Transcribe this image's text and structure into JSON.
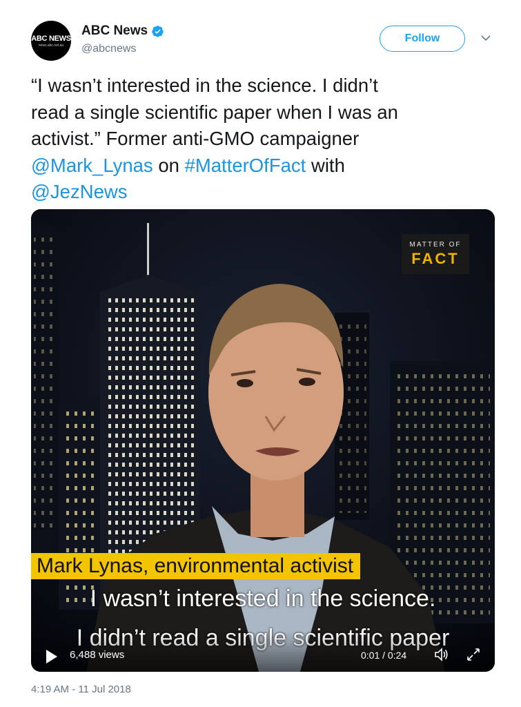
{
  "author": {
    "avatar_text": "ABC NEWS",
    "avatar_subtext": "news.abc.net.au",
    "name": "ABC News",
    "handle": "@abcnews",
    "verified_icon": "verified-badge-icon"
  },
  "follow_label": "Follow",
  "tweet": {
    "line1": "“I wasn’t interested in the science. I didn’t",
    "line2": "read a single scientific paper when I was an",
    "line3": "activist.” Former anti-GMO campaigner",
    "mention1": "@Mark_Lynas",
    "on": " on ",
    "hashtag": "#MatterOfFact",
    "with": " with",
    "mention2": "@JezNews"
  },
  "video": {
    "badge_top": "MATTER OF",
    "badge_bottom": "FACT",
    "nameplate": "Mark Lynas, environmental activist",
    "caption1": "I wasn’t interested in the science.",
    "caption2": "I didn’t read a single scientific paper",
    "views": "6,488 views",
    "time": "0:01 / 0:24",
    "icons": [
      "play-icon",
      "volume-icon",
      "fullscreen-icon"
    ]
  },
  "timestamp": "4:19 AM - 11 Jul 2018",
  "colors": {
    "link": "#1b95e0",
    "follow": "#1da1f2",
    "nameplate": "#f3c400",
    "badge_text": "#f0b400",
    "secondary_text": "#657786"
  }
}
